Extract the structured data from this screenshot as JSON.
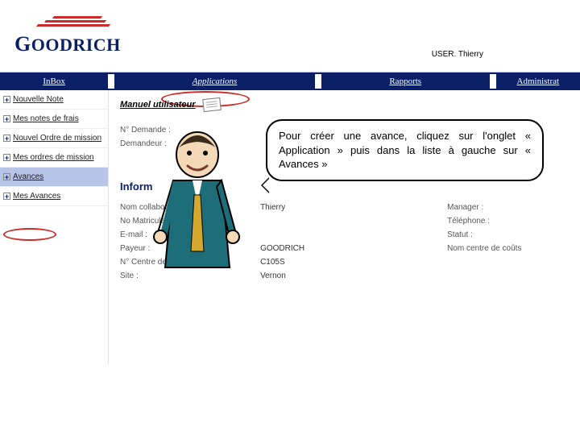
{
  "logo": {
    "text": "GOODRICH"
  },
  "user": {
    "prefix": "USER.",
    "name": "Thierry"
  },
  "nav": {
    "inbox": "InBox",
    "apps": "Applications",
    "rapports": "Rapports",
    "admin": "Administrat"
  },
  "sidebar": {
    "items": [
      {
        "label": "Nouvelle Note"
      },
      {
        "label": "Mes notes de frais"
      },
      {
        "label": "Nouvel Ordre de mission"
      },
      {
        "label": "Mes ordres de mission"
      },
      {
        "label": "Avances"
      },
      {
        "label": "Mes Avances"
      }
    ]
  },
  "main": {
    "manual": "Manuel utilisateur",
    "demande_lbl": "N° Demande :",
    "demandeur_lbl": "Demandeur :",
    "section": "Inform",
    "details": {
      "rows": [
        {
          "l": "Nom collaborateur :",
          "v": "Thierry",
          "r": "Manager :"
        },
        {
          "l": "No Matricule :",
          "v": "",
          "r": "Téléphone :"
        },
        {
          "l": "E-mail :",
          "v": "",
          "r": "Statut :"
        },
        {
          "l": "Payeur :",
          "v": "GOODRICH",
          "r": "Nom centre de coûts"
        },
        {
          "l": "N° Centre de coûts :",
          "v": "C105S",
          "r": ""
        },
        {
          "l": "Site :",
          "v": "Vernon",
          "r": ""
        }
      ]
    }
  },
  "bubble": {
    "text": "Pour créer une avance, cliquez sur l'onglet « Application » puis dans la liste à gauche sur « Avances »"
  }
}
